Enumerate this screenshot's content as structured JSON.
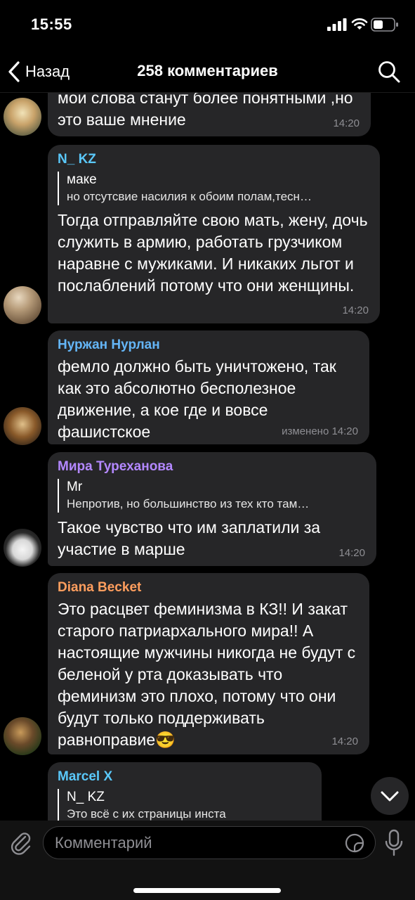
{
  "status_bar": {
    "time": "15:55"
  },
  "nav": {
    "back_label": "Назад",
    "title": "258 комментариев"
  },
  "messages": [
    {
      "author": "",
      "text": "мои слова станут более понятными ,но это ваше мнение",
      "time": "14:20"
    },
    {
      "author": "N_ KZ",
      "author_color": "#5ac8fa",
      "quote_author": "маке",
      "quote_text": "но отсутсвие насилия к обоим полам,тесн…",
      "text": "Тогда отправляйте свою мать, жену, дочь служить в армию, работать грузчиком наравне с мужиками. И никаких льгот и послаблений потому что они женщины.",
      "time": "14:20"
    },
    {
      "author": "Нуржан Нурлан",
      "author_color": "#64b5f6",
      "text": "фемло должно быть уничтожено, так как это абсолютно бесполезное движение, а кое где и вовсе фашистское",
      "time": "изменено 14:20"
    },
    {
      "author": "Мира Туреханова",
      "author_color": "#b388ff",
      "quote_author": "Mr",
      "quote_text": "Непротив, но большинство из тех кто там…",
      "text": "Такое чувство что им заплатили за участие в марше",
      "time": "14:20"
    },
    {
      "author": "Diana Becket",
      "author_color": "#ff9e5e",
      "text": "Это расцвет феминизма в КЗ!! И закат старого патриархального мира!! А настоящие мужчины никогда не будут с беленой у рта доказывать что феминизм это плохо, потому что они будут только поддерживать равноправие😎",
      "time": "14:20"
    },
    {
      "author": "Marcel X",
      "author_color": "#5ac8fa",
      "quote_author": "N_ KZ",
      "quote_text": "Это всё с их страницы инста",
      "text": "",
      "time": ""
    }
  ],
  "input": {
    "placeholder": "Комментарий"
  },
  "colors": {
    "background": "#000000",
    "bubble": "#262628",
    "time": "#8e8e93"
  },
  "icons": [
    "signal-icon",
    "wifi-icon",
    "battery-icon",
    "back-chevron-icon",
    "search-icon",
    "chevron-down-icon",
    "paperclip-icon",
    "sticker-icon",
    "microphone-icon"
  ]
}
